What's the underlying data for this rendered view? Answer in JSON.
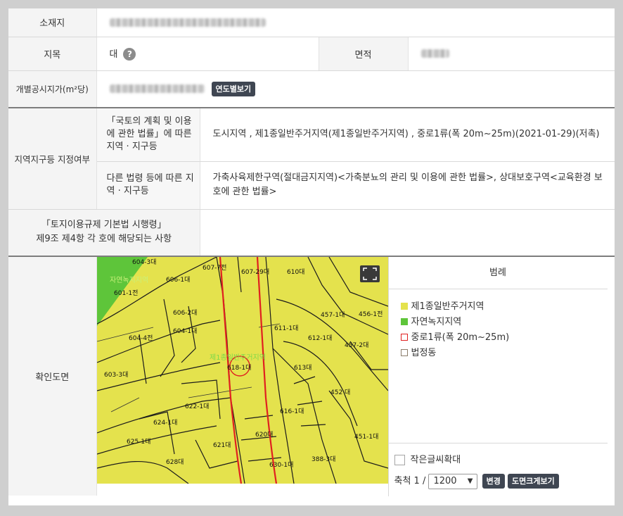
{
  "rows": {
    "location": {
      "label": "소재지"
    },
    "land_category": {
      "label": "지목",
      "value": "대",
      "help": "?"
    },
    "area": {
      "label": "면적"
    },
    "official_price": {
      "label": "개별공시지가(m²당)",
      "button": "연도별보기"
    },
    "zoning": {
      "label": "지역지구등 지정여부",
      "sub1": {
        "label": "「국토의 계획 및 이용에 관한 법률」에 따른 지역 · 지구등",
        "value": "도시지역 , 제1종일반주거지역(제1종일반주거지역) , 중로1류(폭 20m~25m)(2021-01-29)(저촉)"
      },
      "sub2": {
        "label": "다른 법령 등에 따른 지역 · 지구등",
        "value": "가축사육제한구역(절대금지지역)<가축분뇨의 관리 및 이용에 관한 법률>, 상대보호구역<교육환경 보호에 관한 법률>"
      }
    },
    "enforcement": {
      "label_line1": "「토지이용규제 기본법 시행령」",
      "label_line2": "제9조 제4항 각 호에 해당되는 사항",
      "value": ""
    },
    "map": {
      "label": "확인도면"
    }
  },
  "legend": {
    "title": "범례",
    "items": [
      {
        "label": "제1종일반주거지역",
        "color": "#e4e24d",
        "style": "fill"
      },
      {
        "label": "자연녹지지역",
        "color": "#5ec53a",
        "style": "fill"
      },
      {
        "label": "중로1류(폭 20m~25m)",
        "color": "#e02020",
        "style": "outline"
      },
      {
        "label": "법정동",
        "color": "#8b7d6b",
        "style": "outline"
      }
    ]
  },
  "controls": {
    "enlarge_text_label": "작은글씨확대",
    "scale_label": "축척 1 /",
    "scale_value": "1200",
    "change_button": "변경",
    "view_large_button": "도면크게보기"
  },
  "map_labels": [
    "604-3대",
    "606-1대",
    "601-1전",
    "606-2대",
    "604-1대",
    "604-4전",
    "607-7전",
    "607-29대",
    "610대",
    "611-1대",
    "612-1대",
    "613대",
    "618-1대",
    "616-1대",
    "622-1대",
    "624-1대",
    "625-1대",
    "628대",
    "621대",
    "620대",
    "452 대",
    "451-1대",
    "457-1대",
    "456-1전",
    "457-2대",
    "603-3대",
    "630-1대",
    "388-3대",
    "자연녹지지역",
    "제1종일반주거지역"
  ],
  "colors": {
    "residential": "#e4e24d",
    "green": "#5ec53a",
    "road": "#e02020",
    "header_bg": "#f4f4f4",
    "dark_button": "#3f4652"
  }
}
